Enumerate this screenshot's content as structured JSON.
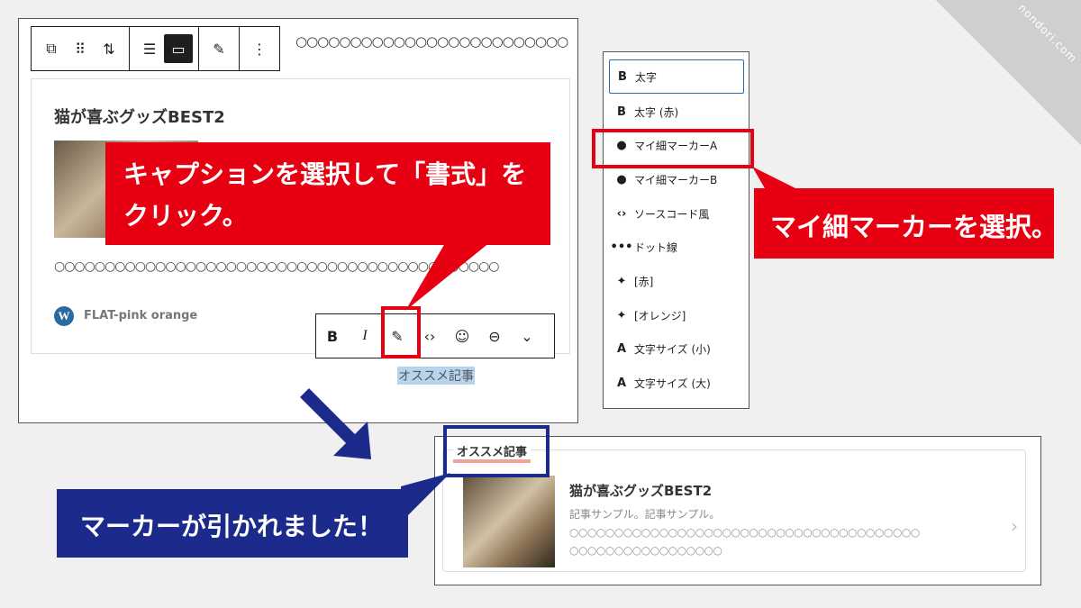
{
  "watermark": "nondori.com",
  "editor": {
    "top_dots": "○○○○○○○○○○○○○○○○○○○○○○○○○",
    "toolbar": {
      "block_icon": "⧉",
      "drag_icon": "⠿",
      "move_icon": "⇅",
      "align_icon": "☰",
      "caption_icon": "▭",
      "highlight_icon": "✎",
      "more_icon": "⋮"
    },
    "card": {
      "title": "猫が喜ぶグッズBEST2",
      "dots": "○○○○○○○○○○○○○○○○○○○○○○○○○○○○○○○○○○○○○○○○○○○○",
      "wp_logo": "W",
      "author": "FLAT-pink orange"
    },
    "format_toolbar": {
      "bold": "B",
      "italic": "I",
      "highlight": "✎",
      "code": "‹›",
      "emoji": "☺",
      "link": "⊖",
      "more": "⌄"
    },
    "caption": "オススメ記事"
  },
  "callouts": {
    "red1_line1": "キャプションを選択して「書式」を",
    "red1_line2": "クリック。",
    "red2": "マイ細マーカーを選択。",
    "blue": "マーカーが引かれました！"
  },
  "dropdown": {
    "items": [
      {
        "icon": "B",
        "label": "太字"
      },
      {
        "icon": "B",
        "label": "太字 (赤)"
      },
      {
        "icon": "●",
        "label": "マイ細マーカーA"
      },
      {
        "icon": "●",
        "label": "マイ細マーカーB"
      },
      {
        "icon": "‹›",
        "label": "ソースコード風"
      },
      {
        "icon": "•••",
        "label": "ドット線"
      },
      {
        "icon": "✦",
        "label": "[赤]"
      },
      {
        "icon": "✦",
        "label": "[オレンジ]"
      },
      {
        "icon": "A",
        "label": "文字サイズ (小)"
      },
      {
        "icon": "A",
        "label": "文字サイズ (大)"
      }
    ]
  },
  "result": {
    "label": "オススメ記事",
    "title": "猫が喜ぶグッズBEST2",
    "desc": "記事サンプル。記事サンプル。",
    "dots1": "○○○○○○○○○○○○○○○○○○○○○○○○○○○○○○○○○○○○○○○",
    "dots2": "○○○○○○○○○○○○○○○○○",
    "chevron": "›"
  },
  "colors": {
    "red": "#e60012",
    "navy": "#1c2a8c",
    "highlight": "#b6d4f0",
    "marker": "#f5a0a0"
  }
}
